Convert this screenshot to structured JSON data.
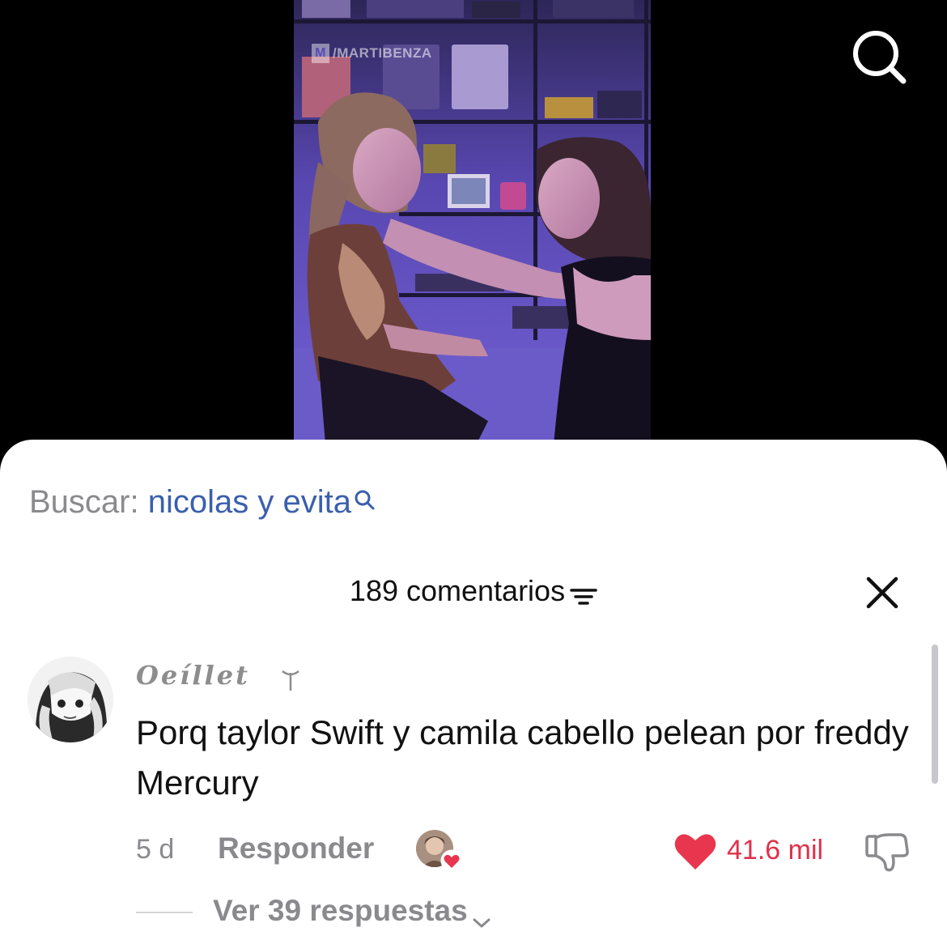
{
  "video": {
    "watermark": "/MARTIBENZA",
    "watermark_logo": "M",
    "top_right_icon": "search-icon"
  },
  "search_suggestion": {
    "label": "Buscar: ",
    "query": "nicolas y evita",
    "icon": "search-icon",
    "query_color": "#3b5fad"
  },
  "comments_panel": {
    "count_label": "189 comentarios",
    "filter_icon": "filter-icon",
    "close_icon": "close-icon"
  },
  "comment": {
    "username": "Oeíllet",
    "flair_icon": "symbol-icon",
    "text": "Porq taylor Swift y camila cabello pelean por freddy Mercury",
    "time": "5 d",
    "reply_label": "Responder",
    "like_count": "41.6 mil",
    "liked": true,
    "like_color": "#e8364f",
    "view_replies_label": "Ver 39 respuestas"
  }
}
